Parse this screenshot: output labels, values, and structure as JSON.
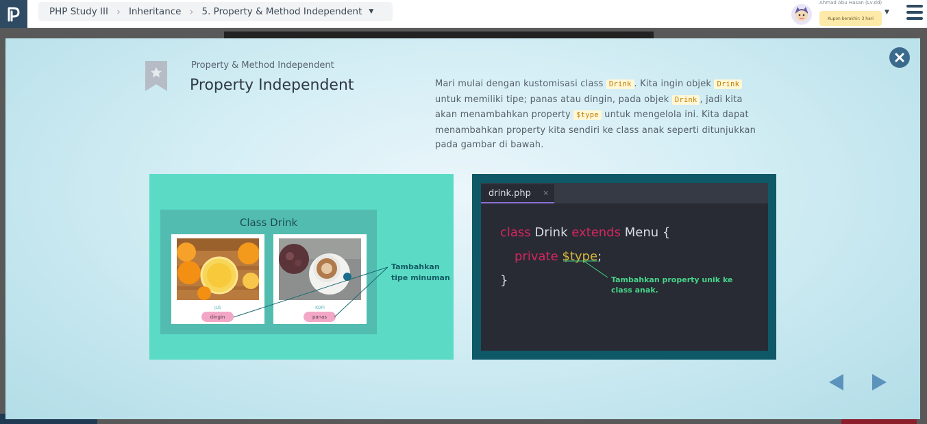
{
  "breadcrumb": {
    "items": [
      "PHP Study III",
      "Inheritance",
      "5. Property & Method Independent"
    ]
  },
  "user": {
    "name": "Ahmad Abu Hasan (Lv.dd)",
    "coupon": "Kupon berakhir: 3 hari"
  },
  "lesson": {
    "subtitle": "Property & Method Independent",
    "title": "Property Independent",
    "description": {
      "p1": "Mari mulai dengan kustomisasi class ",
      "c1": "Drink",
      "p2": ". Kita ingin objek ",
      "c2": "Drink",
      "p3": " untuk memiliki tipe; panas atau dingin, pada objek ",
      "c3": "Drink",
      "p4": ", jadi kita akan menambahkan property ",
      "c4": "$type",
      "p5": " untuk mengelola ini. Kita dapat menambahkan property kita sendiri ke class anak seperti ditunjukkan pada gambar di bawah."
    }
  },
  "illustration": {
    "class_title": "Class Drink",
    "card1": {
      "name": "JUS",
      "type": "dingin"
    },
    "card2": {
      "name": "KOPI",
      "type": "panas"
    },
    "note": "Tambahkan tipe minuman"
  },
  "editor": {
    "tab": "drink.php",
    "tab_close": "×",
    "line1": {
      "kw1": "class",
      "name": " Drink ",
      "kw2": "extends",
      "rest": " Menu {"
    },
    "line2": {
      "kw": "private",
      "var": "$type",
      "end": ";"
    },
    "line3": "}",
    "note": "Tambahkan property unik ke class anak."
  },
  "colors": {
    "accent": "#2f4b63",
    "close": "#3a6b8c",
    "nav_arrow": "#5b93bd",
    "keyword": "#d5265f",
    "variable": "#d5b83b",
    "note_green": "#47d48a"
  },
  "icons": {
    "logo": "progate-logo-icon",
    "close": "close-icon",
    "menu": "hamburger-menu-icon",
    "bookmark": "bookmark-star-icon",
    "prev": "arrow-left-icon",
    "next": "arrow-right-icon"
  }
}
